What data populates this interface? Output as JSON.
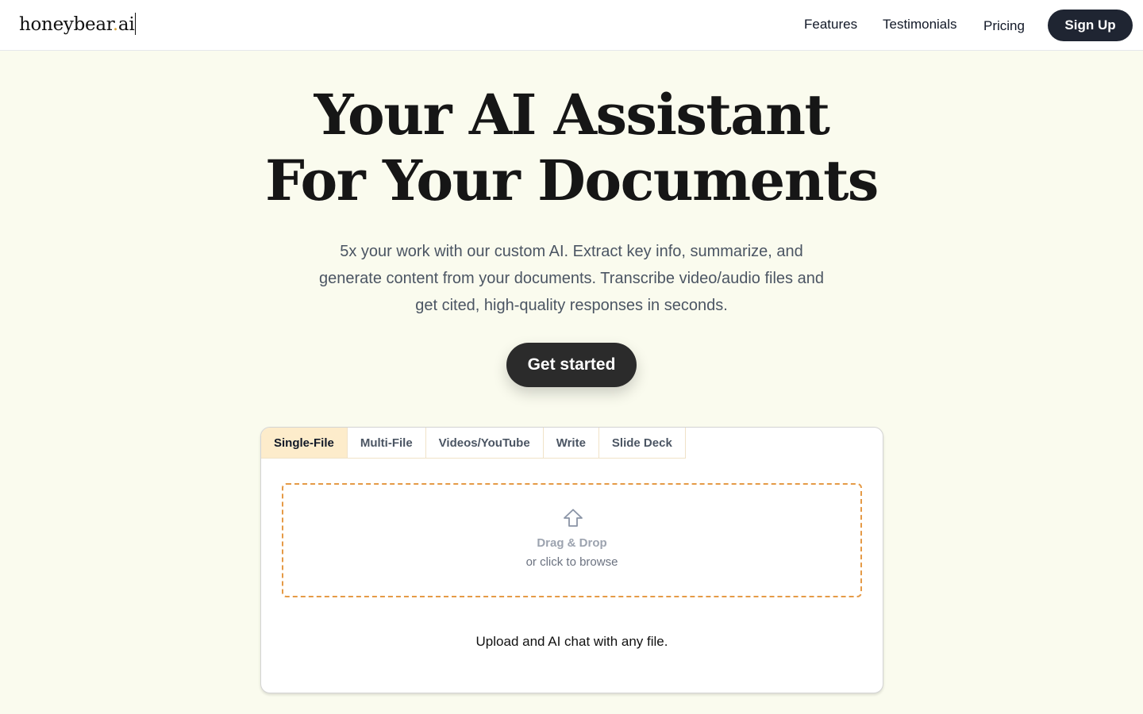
{
  "header": {
    "logo_main": "honeybear",
    "logo_dot": ".",
    "logo_suffix": "ai",
    "nav": {
      "features": "Features",
      "testimonials": "Testimonials",
      "pricing": "Pricing"
    },
    "signup_label": "Sign Up"
  },
  "hero": {
    "title_line1": "Your AI Assistant",
    "title_line2": "For Your Documents",
    "subtitle": "5x your work with our custom AI. Extract key info, summarize, and generate content from your documents. Transcribe video/audio files and get cited, high-quality responses in seconds.",
    "cta_label": "Get started"
  },
  "uploader": {
    "tabs": [
      "Single-File",
      "Multi-File",
      "Videos/YouTube",
      "Write",
      "Slide Deck"
    ],
    "active_tab": "Single-File",
    "upload_icon": "arrow-up-outline-icon",
    "drop_title": "Drag & Drop",
    "drop_subtitle": "or click to browse",
    "caption": "Upload and AI chat with any file."
  },
  "colors": {
    "page_background": "#fafbee",
    "accent_dashed_border": "#e59a46",
    "active_tab": "#fdeccb",
    "button_dark": "#1f2532",
    "logo_dot": "#d9a53b"
  }
}
